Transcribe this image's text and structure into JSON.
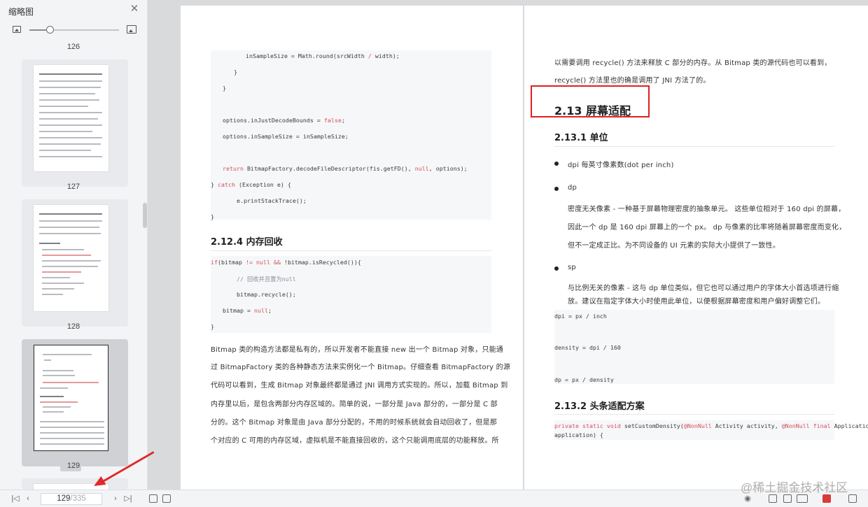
{
  "sidebar": {
    "title": "缩略图",
    "labels": [
      "126",
      "127",
      "128",
      "129"
    ],
    "selected_page": "129",
    "zoom_level": 0.2
  },
  "left_page": {
    "code1": [
      "        inSampleSize = Math.round(srcWidth / width);",
      "    }",
      "}",
      "",
      "options.inJustDecodeBounds = false;",
      "options.inSampleSize = inSampleSize;",
      "",
      "return BitmapFactory.decodeFileDescriptor(fis.getFD(), null, options);",
      "} catch (Exception e) {",
      "    e.printStackTrace();",
      "}"
    ],
    "heading": "2.12.4  内存回收",
    "code2": [
      "if(bitmap != null && !bitmap.isRecycled()){",
      "    // 回收并且置为null",
      "    bitmap.recycle();",
      "    bitmap = null;",
      "}"
    ],
    "paragraph": [
      "Bitmap  类的构造方法都是私有的，所以开发者不能直接  new  出一个  Bitmap  对象，只能通",
      "过  BitmapFactory  类的各种静态方法来实例化一个  Bitmap。仔细查看  BitmapFactory  的源",
      "代码可以看到，生成  Bitmap  对象最终都是通过  JNI  调用方式实现的。所以，加载  Bitmap  到",
      "内存里以后，是包含两部分内存区域的。简单的说，一部分是 Java  部分的，一部分是  C  部",
      "分的。这个  Bitmap  对象是由  Java  部分分配的，不用的时候系统就会自动回收了，但是那",
      "个对应的  C  可用的内存区域，虚拟机是不能直接回收的，这个只能调用底层的功能释放。所"
    ]
  },
  "right_page": {
    "intro": [
      "以需要调用  recycle()  方法来释放  C  部分的内存。从  Bitmap  类的源代码也可以看到，",
      "recycle()  方法里也的确是调用了  JNI  方法了的。"
    ],
    "section_title": "2.13  屏幕适配",
    "sub1": "2.13.1  单位",
    "dpi_label": "dpi  每英寸像素数(dot per inch)",
    "dp_label": "dp",
    "dp_desc": [
      "密度无关像素 - 一种基于屏幕物理密度的抽象单元。 这些单位相对于  160 dpi  的屏幕，",
      "因此一个  dp  是  160 dpi  屏幕上的一个  px。  dp  与像素的比率将随着屏幕密度而变化，",
      "但不一定成正比。为不同设备的  UI  元素的实际大小提供了一致性。"
    ],
    "sp_label": "sp",
    "sp_desc": [
      "与比例无关的像素 - 这与  dp  单位类似，但它也可以通过用户的字体大小首选项进行缩",
      "放。建议在指定字体大小时使用此单位，以便根据屏幕密度和用户偏好调整它们。"
    ],
    "code": [
      "dpi = px / inch",
      "",
      "density = dpi / 160",
      "",
      "dp = px / density"
    ],
    "sub2": "2.13.2  头条适配方案",
    "code_b1": "private static void setCustomDensity(@NonNull Activity activity, @NonNull final Application",
    "code_b2": "application) {"
  },
  "bottombar": {
    "current_page": "129",
    "total_pages": "/335",
    "watermark": "@稀土掘金技术社区"
  },
  "colors": {
    "annotation_red": "#e02020",
    "code_keyword": "#d4505b"
  }
}
